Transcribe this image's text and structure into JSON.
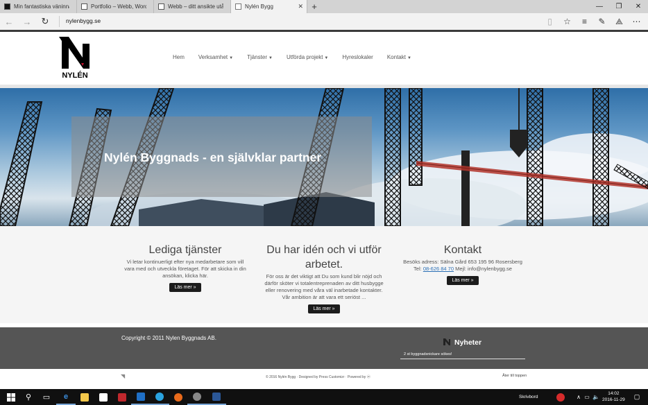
{
  "browser": {
    "tabs": [
      {
        "label": "Min fantastiska väninna av l"
      },
      {
        "label": "Portfolio – Webb, WordPres"
      },
      {
        "label": "Webb – ditt ansikte utåt | Sk"
      },
      {
        "label": "Nylén Bygg",
        "active": true
      }
    ],
    "url": "nylenbygg.se"
  },
  "site": {
    "logo_text": "NYLÉN",
    "nav": [
      {
        "label": "Hem",
        "dropdown": false
      },
      {
        "label": "Verksamhet",
        "dropdown": true
      },
      {
        "label": "Tjänster",
        "dropdown": true
      },
      {
        "label": "Utförda projekt",
        "dropdown": true
      },
      {
        "label": "Hyreslokaler",
        "dropdown": false
      },
      {
        "label": "Kontakt",
        "dropdown": true
      }
    ],
    "hero_title": "Nylén Byggnads - en självklar partner",
    "columns": {
      "jobs": {
        "title": "Lediga tjänster",
        "text": "Vi letar kontinuerligt efter nya medarbetare som vill vara med och utveckla företaget. För att skicka in din ansökan, klicka här.",
        "button": "Läs mer »"
      },
      "idea": {
        "title": "Du har idén och vi utför arbetet.",
        "text": "För oss är det viktigt att Du som kund blir nöjd och därför sköter vi totalentreprenaden av ditt husbygge eller renovering med våra väl inarbetade kontakter. Vår ambition är att vara ett seriöst ...",
        "button": "Läs mer »"
      },
      "contact": {
        "title": "Kontakt",
        "address": "Besöks adress: Sälna Gård 653 195 96 Rosersberg",
        "tel_label": "Tel:",
        "tel": "08-626 84 70",
        "mail": "Mejl: info@nylenbygg.se",
        "button": "Läs mer »"
      }
    },
    "footer": {
      "copyright": "Copyright © 2011 Nylen Byggnads AB.",
      "news_title": "Nyheter",
      "news_item": "2 st byggnadsnickare sökes!",
      "credits": "© 2016 Nylén Bygg · Designed by Press Customizr · Powered by",
      "to_top": "Åter till toppen"
    }
  },
  "taskbar": {
    "desktop_label": "Skrivbord",
    "time": "14:02",
    "date": "2016-11-29"
  }
}
